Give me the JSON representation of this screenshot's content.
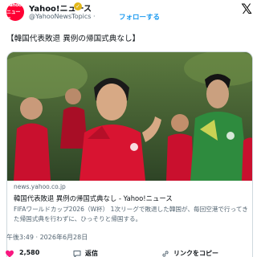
{
  "account": {
    "avatar_text": "Yahoo!ニュース",
    "name": "Yahoo!ニュース",
    "verified_mark": "✓",
    "handle": "@YahooNewsTopics",
    "separator": "·",
    "follow_label": "フォローする"
  },
  "x_logo": "𝕏",
  "tweet": {
    "text": "【韓国代表敗退 異例の帰国式典なし】"
  },
  "card": {
    "domain": "news.yahoo.co.jp",
    "title": "韓国代表敗退 異例の帰国式典なし - Yahoo!ニュース",
    "description": "FIFAワールドカップ2026（W杯） 1次リーグで敗退した韓国が、毎回空港で行ってきた帰国式典を行わずに、ひっそりと帰国する。"
  },
  "timestamp": "午後3:49 · 2026年6月28日",
  "actions": {
    "like_count": "2,580",
    "reply_label": "返信",
    "link_label": "リンクをコピー"
  },
  "colors": {
    "brand_red": "#ff0033",
    "follow_blue": "#1d9bf0",
    "text_secondary": "#536471",
    "like_red": "#f91880"
  },
  "icons": [
    "yahoo-avatar",
    "verified-badge-icon",
    "x-logo-icon",
    "heart-icon",
    "reply-icon",
    "link-icon"
  ]
}
